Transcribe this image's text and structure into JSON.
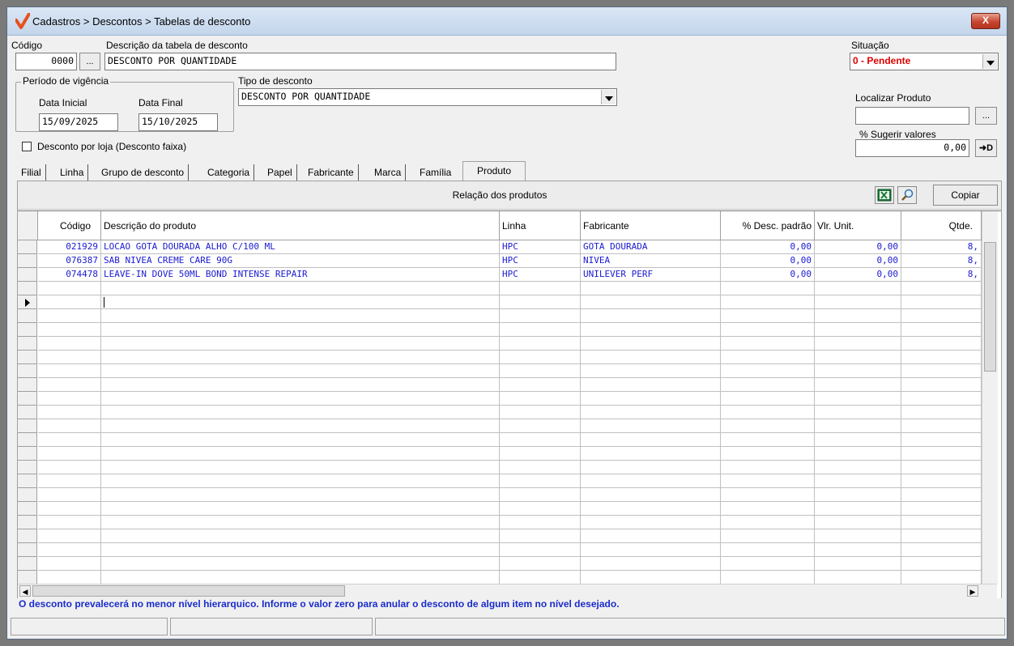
{
  "window": {
    "title": "Cadastros > Descontos > Tabelas de desconto",
    "close_label": "X"
  },
  "form": {
    "codigo_label": "Código",
    "codigo_value": "0000",
    "codigo_lookup_label": "...",
    "descricao_label": "Descrição da tabela de desconto",
    "descricao_value": "DESCONTO POR QUANTIDADE",
    "situacao_label": "Situação",
    "situacao_value": "0 - Pendente",
    "situacao_color": "#e00000",
    "periodo_label": "Período de vigência",
    "data_inicial_label": "Data Inicial",
    "data_inicial_value": "15/09/2025",
    "data_final_label": "Data Final",
    "data_final_value": "15/10/2025",
    "tipo_label": "Tipo de desconto",
    "tipo_value": "DESCONTO POR QUANTIDADE",
    "localizar_label": "Localizar Produto",
    "localizar_value": "",
    "localizar_lookup_label": "...",
    "sugerir_label": "% Sugerir valores",
    "sugerir_value": "0,00",
    "apply_label": "➜D",
    "desconto_loja_label": "Desconto por loja (Desconto faixa)",
    "desconto_loja_checked": false
  },
  "tabs": [
    "Filial",
    "Linha",
    "Grupo de desconto",
    "Categoria",
    "Papel",
    "Fabricante",
    "Marca",
    "Família",
    "Produto"
  ],
  "active_tab": "Produto",
  "panel": {
    "title": "Relação dos produtos",
    "excel_icon": "excel-icon",
    "search_icon": "search-icon",
    "copiar_label": "Copiar"
  },
  "grid": {
    "columns": [
      "Código",
      "Descrição do produto",
      "Linha",
      "Fabricante",
      "% Desc. padrão",
      "Vlr. Unit.",
      "Qtde."
    ],
    "rows": [
      {
        "codigo": "021929",
        "descricao": "LOCAO GOTA DOURADA ALHO C/100 ML",
        "linha": "HPC",
        "fabricante": "GOTA DOURADA",
        "desc_padrao": "0,00",
        "vlr_unit": "0,00",
        "qtde": "8,"
      },
      {
        "codigo": "076387",
        "descricao": "SAB NIVEA CREME CARE 90G",
        "linha": "HPC",
        "fabricante": "NIVEA",
        "desc_padrao": "0,00",
        "vlr_unit": "0,00",
        "qtde": "8,"
      },
      {
        "codigo": "074478",
        "descricao": "LEAVE-IN DOVE 50ML BOND INTENSE REPAIR",
        "linha": "HPC",
        "fabricante": "UNILEVER PERF",
        "desc_padrao": "0,00",
        "vlr_unit": "0,00",
        "qtde": "8,"
      }
    ],
    "row_color": "#1a1ad0"
  },
  "info_message": "O desconto prevalecerá no menor nível hierarquico. Informe o valor zero para anular o desconto de algum item no nível desejado.",
  "status_panels": [
    "",
    "",
    ""
  ]
}
